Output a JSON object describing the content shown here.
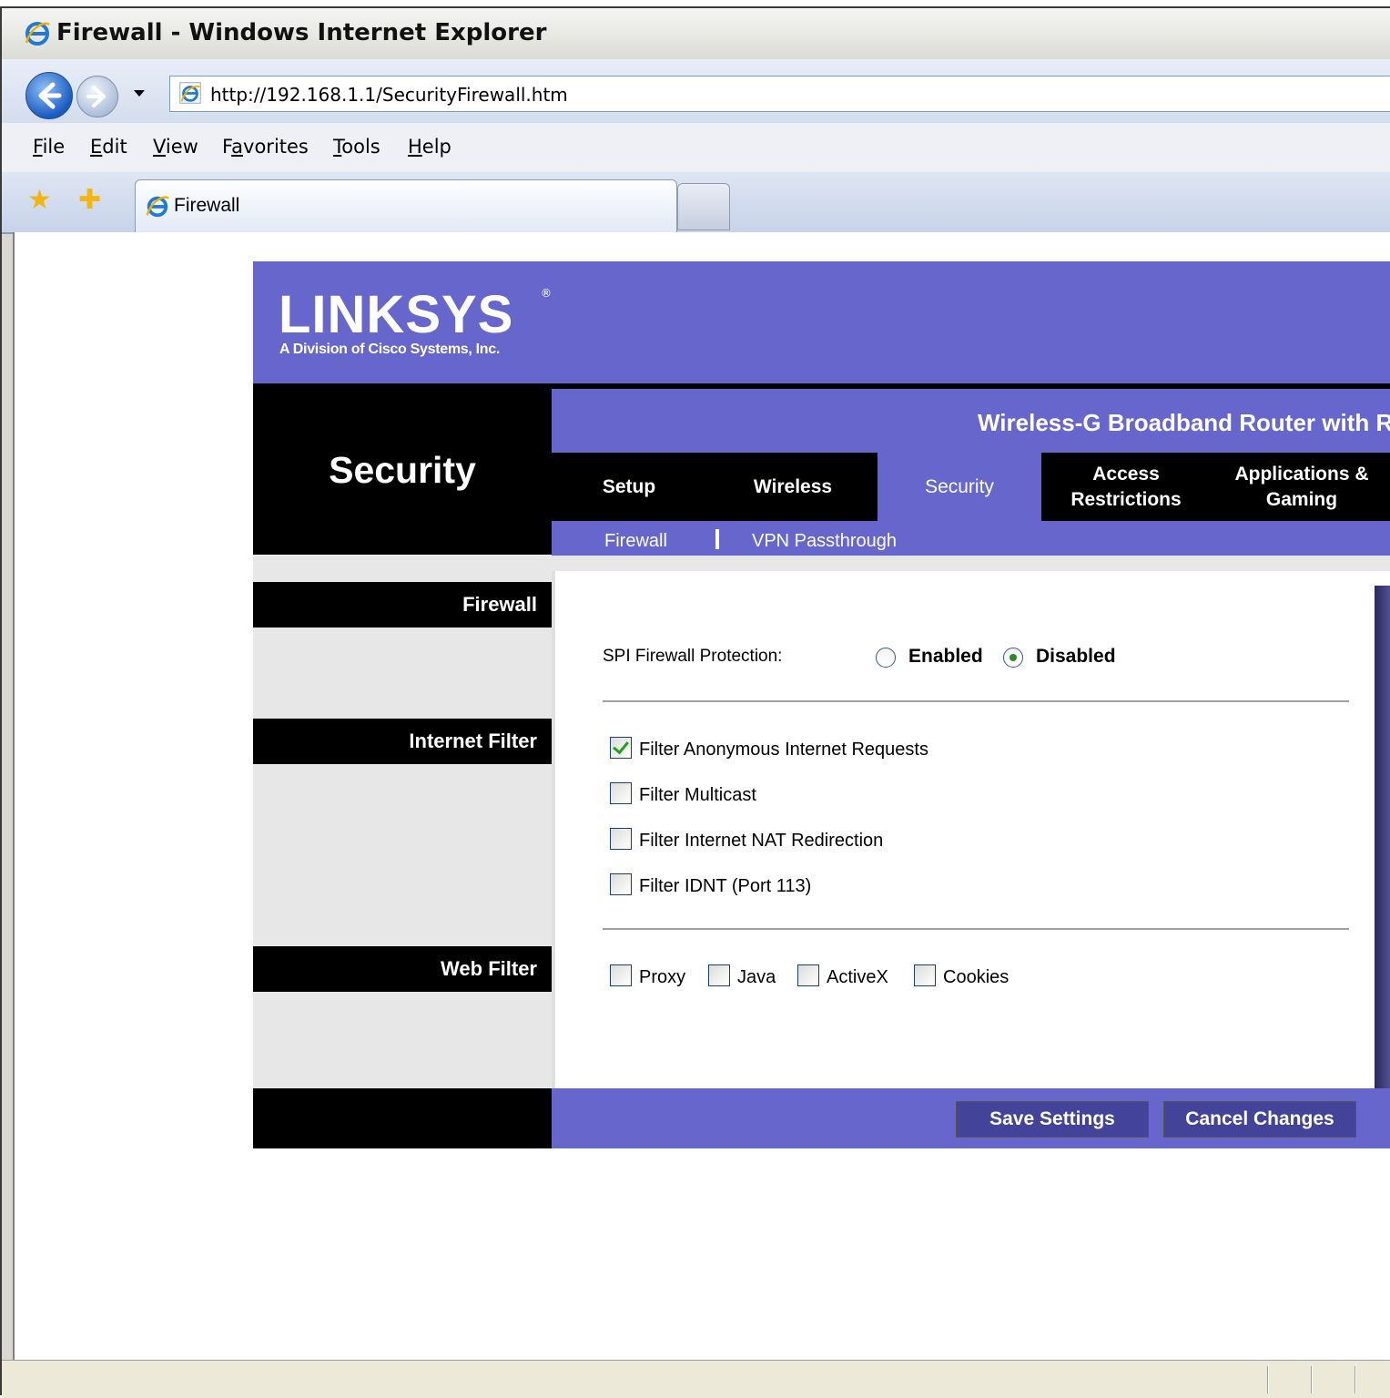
{
  "window": {
    "title": "Firewall - Windows Internet Explorer",
    "url": "http://192.168.1.1/SecurityFirewall.htm",
    "menu": [
      "File",
      "Edit",
      "View",
      "Favorites",
      "Tools",
      "Help"
    ],
    "menu_access_keys": [
      "F",
      "E",
      "V",
      "a",
      "T",
      "H"
    ],
    "tab_title": "Firewall"
  },
  "router": {
    "brand": "LINKSYS",
    "brand_sub": "A Division of Cisco Systems, Inc.",
    "product": "Wireless-G Broadband Router with R",
    "section_title": "Security",
    "tabs": [
      {
        "label": "Setup",
        "active": false
      },
      {
        "label": "Wireless",
        "active": false
      },
      {
        "label": "Security",
        "active": true
      },
      {
        "label": "Access Restrictions",
        "active": false
      },
      {
        "label": "Applications & Gaming",
        "active": false
      }
    ],
    "subtabs": [
      "Firewall",
      "VPN Passthrough"
    ],
    "sections": {
      "firewall": "Firewall",
      "internet_filter": "Internet Filter",
      "web_filter": "Web Filter"
    },
    "spi": {
      "label": "SPI Firewall Protection:",
      "options": [
        "Enabled",
        "Disabled"
      ],
      "selected": "Disabled"
    },
    "internet_filters": [
      {
        "label": "Filter Anonymous Internet Requests",
        "checked": true
      },
      {
        "label": "Filter Multicast",
        "checked": false
      },
      {
        "label": "Filter Internet NAT Redirection",
        "checked": false
      },
      {
        "label": "Filter IDNT (Port 113)",
        "checked": false
      }
    ],
    "web_filters": [
      {
        "label": "Proxy",
        "checked": false
      },
      {
        "label": "Java",
        "checked": false
      },
      {
        "label": "ActiveX",
        "checked": false
      },
      {
        "label": "Cookies",
        "checked": false
      }
    ],
    "buttons": {
      "save": "Save Settings",
      "cancel": "Cancel Changes"
    }
  },
  "colors": {
    "accent": "#6666cc",
    "button": "#434399",
    "black": "#000000"
  }
}
